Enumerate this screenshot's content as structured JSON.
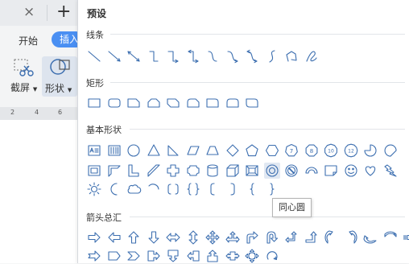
{
  "app": {
    "tab_close": "×",
    "new_tab": "+",
    "menu": {
      "start": "开始",
      "insert": "插入"
    },
    "tools": {
      "screenshot": "截屏",
      "shapes": "形状"
    }
  },
  "ruler": {
    "ticks": [
      "2",
      "4",
      "6"
    ]
  },
  "panel": {
    "title": "预设",
    "categories": [
      {
        "label": "线条",
        "icons": [
          "line-icon",
          "arrow-line-icon",
          "double-arrow-line-icon",
          "elbow-connector-icon",
          "elbow-arrow-connector-icon",
          "elbow-double-arrow-connector-icon",
          "curved-connector-icon",
          "curved-arrow-connector-icon",
          "curved-double-arrow-connector-icon",
          "curve-icon",
          "freeform-icon",
          "scribble-icon"
        ]
      },
      {
        "label": "矩形",
        "icons": [
          "rectangle-icon",
          "rounded-rectangle-icon",
          "snip-single-corner-icon",
          "snip-same-side-icon",
          "snip-diagonal-icon",
          "snip-round-icon",
          "round-single-corner-icon",
          "round-same-side-icon",
          "round-diagonal-icon"
        ]
      },
      {
        "label": "基本形状",
        "icons": [
          "text-box-icon",
          "vertical-text-box-icon",
          "oval-icon",
          "triangle-icon",
          "right-triangle-icon",
          "parallelogram-icon",
          "trapezoid-icon",
          "diamond-icon",
          "pentagon-icon",
          "hexagon-icon",
          "heptagon-icon",
          "octagon-icon",
          "decagon-icon",
          "dodecagon-icon",
          "pie-icon",
          "chord-icon",
          "frame-icon",
          "half-frame-icon",
          "l-shape-icon",
          "diagonal-stripe-icon",
          "plus-icon",
          "plaque-icon",
          "can-icon",
          "cube-icon",
          "bevel-icon",
          "donut-icon",
          "no-symbol-icon",
          "block-arc-icon",
          "folded-corner-icon",
          "smiley-face-icon",
          "heart-icon",
          "lightning-bolt-icon",
          "sun-icon",
          "moon-icon",
          "cloud-icon",
          "arc-icon",
          "double-bracket-icon",
          "double-brace-icon",
          "left-bracket-icon",
          "right-bracket-icon",
          "left-brace-icon",
          "right-brace-icon"
        ]
      },
      {
        "label": "箭头总汇",
        "icons": [
          "right-arrow-icon",
          "left-arrow-icon",
          "up-arrow-icon",
          "down-arrow-icon",
          "left-right-arrow-icon",
          "up-down-arrow-icon",
          "quad-arrow-icon",
          "left-right-up-arrow-icon",
          "bent-arrow-icon",
          "u-turn-arrow-icon",
          "left-up-arrow-icon",
          "bent-up-arrow-icon",
          "curved-right-arrow-icon",
          "curved-left-arrow-icon",
          "curved-up-arrow-icon",
          "curved-down-arrow-icon",
          "striped-right-arrow-icon",
          "notched-right-arrow-icon",
          "pentagon-arrow-icon",
          "chevron-arrow-icon",
          "right-arrow-callout-icon",
          "down-arrow-callout-icon",
          "left-arrow-callout-icon",
          "up-arrow-callout-icon",
          "left-right-arrow-callout-icon",
          "quad-arrow-callout-icon",
          "circular-arrow-icon"
        ]
      }
    ],
    "hovered_icon": "donut-icon",
    "tooltip": "同心圆"
  },
  "colors": {
    "accent": "#4a8ff2",
    "shape_stroke": "#3d6fb0",
    "panel_bg": "#ffffff"
  }
}
